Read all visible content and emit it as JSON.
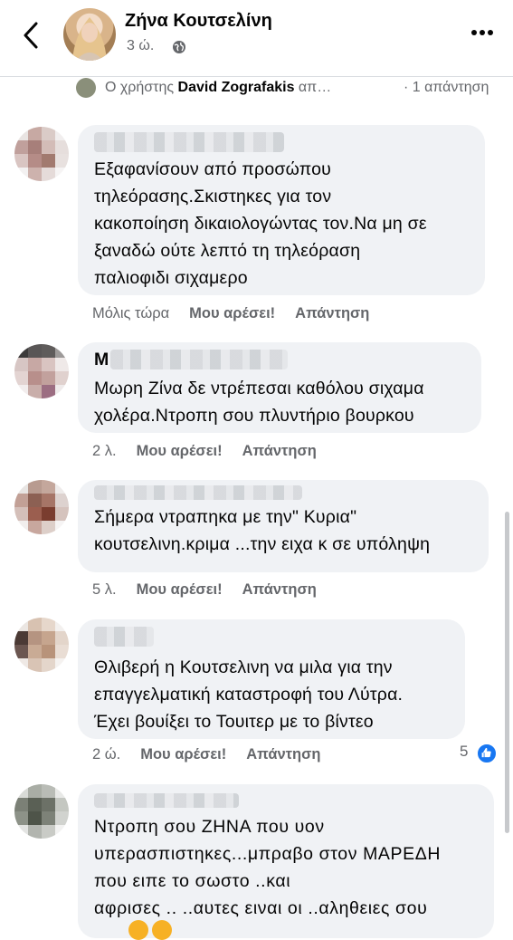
{
  "header": {
    "name": "Ζήνα Κουτσελίνη",
    "time": "3 ώ.",
    "colors": {
      "text": "#050505",
      "secondary": "#65676b",
      "bubble": "#f0f2f5",
      "like": "#1877f2"
    }
  },
  "reply_strip": {
    "prefix": "Ο χρήστης ",
    "user": "David Zografakis",
    "suffix": " απ…",
    "count": "· 1 απάντηση"
  },
  "comments": [
    {
      "author_visible": "",
      "text": "Εξαφανίσουν από προσώπου\nτηλεόρασης.Σκιστηκες για τον\nκακοποίηση δικαιολογώντας τον.Να μη σε\nξαναδώ ούτε λεπτό τη τηλεόραση\nπαλιοφιδι σιχαμερο",
      "time": "Μόλις τώρα",
      "like": "Μου αρέσει!",
      "reply": "Απάντηση"
    },
    {
      "author_visible": "Μ",
      "text": "Μωρη Ζίνα δε ντρέπεσαι καθόλου σιχαμα\nχολέρα.Ντροπη σου πλυντήριο βουρκου",
      "time": "2 λ.",
      "like": "Μου αρέσει!",
      "reply": "Απάντηση"
    },
    {
      "author_visible": "",
      "text": "Σήμερα ντραπηκα με την\" Κυρια\"\nκουτσελινη.κριμα ...την ειχα κ σε υπόληψη",
      "time": "5 λ.",
      "like": "Μου αρέσει!",
      "reply": "Απάντηση"
    },
    {
      "author_visible": "",
      "text": "Θλιβερή η Κουτσελινη να μιλα για την\nεπαγγελματική καταστροφή του Λύτρα.\nΈχει βουίξει το Τουιτερ με το βίντεο",
      "time": "2 ώ.",
      "like": "Μου αρέσει!",
      "reply": "Απάντηση",
      "reactions": "5"
    },
    {
      "author_visible": "",
      "text": "Ντροπη  σου  ΖΗΝΑ  που  υον\nυπερασπιστηκες...μπραβο  στον  ΜΑΡΕΔΗ\nπου  ειπε  το  σωστο  ..και\nαφρισες  ..  ..αυτες  ειναι  οι  ..αληθειες  σου",
      "time": "",
      "like": "",
      "reply": ""
    }
  ]
}
